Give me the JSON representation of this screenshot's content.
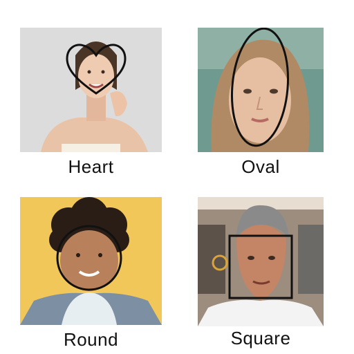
{
  "panels": [
    {
      "label": "Heart",
      "outline": "heart-shape"
    },
    {
      "label": "Oval",
      "outline": "oval-shape"
    },
    {
      "label": "Round",
      "outline": "circle-shape"
    },
    {
      "label": "Square",
      "outline": "square-shape"
    }
  ],
  "colors": {
    "page_background": "#ffffff",
    "outline_stroke": "#111111",
    "heart_bg": "#dcdcdc",
    "oval_bg": "#6f9a8f",
    "round_bg": "#f1c75a",
    "square_bg": "#9c8d7e"
  }
}
